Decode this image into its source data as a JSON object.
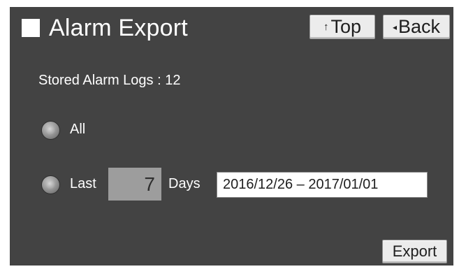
{
  "header": {
    "title": "Alarm Export",
    "top_button": {
      "icon": "arrow-up-icon",
      "glyph": "↑",
      "label": "Top"
    },
    "back_button": {
      "icon": "triangle-left-icon",
      "glyph": "◂",
      "label": "Back"
    }
  },
  "status": {
    "stored_logs_text": "Stored Alarm Logs : 12"
  },
  "options": {
    "all_label": "All",
    "last_label": "Last",
    "days_value": "7",
    "days_label": "Days",
    "date_range": "2016/12/26 – 2017/01/01"
  },
  "footer": {
    "export_label": "Export"
  },
  "colors": {
    "background": "#434343",
    "button_face": "#ececec",
    "days_box": "#9d9d9d",
    "text_light": "#ffffff",
    "text_dark": "#1e1e1e"
  }
}
